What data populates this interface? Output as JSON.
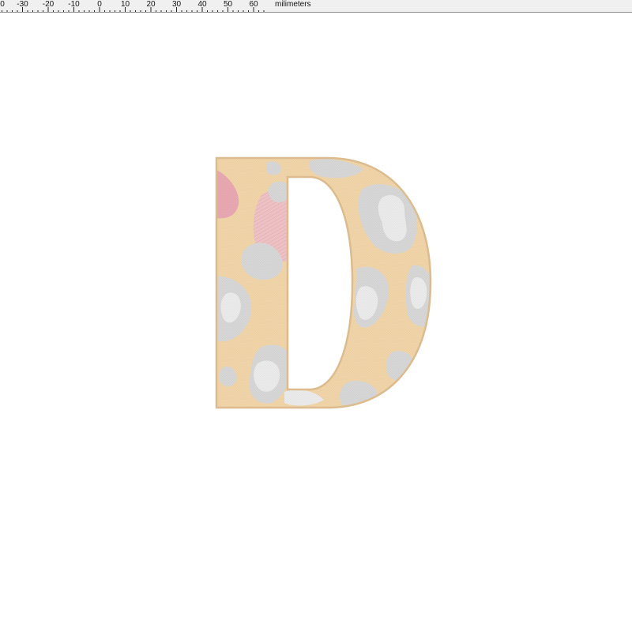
{
  "ruler": {
    "unit_label": "milimeters",
    "ticks": [
      {
        "label": "0",
        "mm": -40
      },
      {
        "label": "-30",
        "mm": -30
      },
      {
        "label": "-20",
        "mm": -20
      },
      {
        "label": "-10",
        "mm": -10
      },
      {
        "label": "0",
        "mm": 0
      },
      {
        "label": "10",
        "mm": 10
      },
      {
        "label": "20",
        "mm": 20
      },
      {
        "label": "30",
        "mm": 30
      },
      {
        "label": "40",
        "mm": 40
      },
      {
        "label": "50",
        "mm": 50
      },
      {
        "label": "60",
        "mm": 60
      }
    ]
  },
  "design": {
    "letter": "D",
    "colors": {
      "fill": "#f2d6aa",
      "outline": "#dcbc8e",
      "patch_gray": "#d8d8d8",
      "patch_light": "#ececec",
      "patch_pink": "#eaa9b2",
      "patch_pink_light": "#f1c4c6"
    }
  }
}
